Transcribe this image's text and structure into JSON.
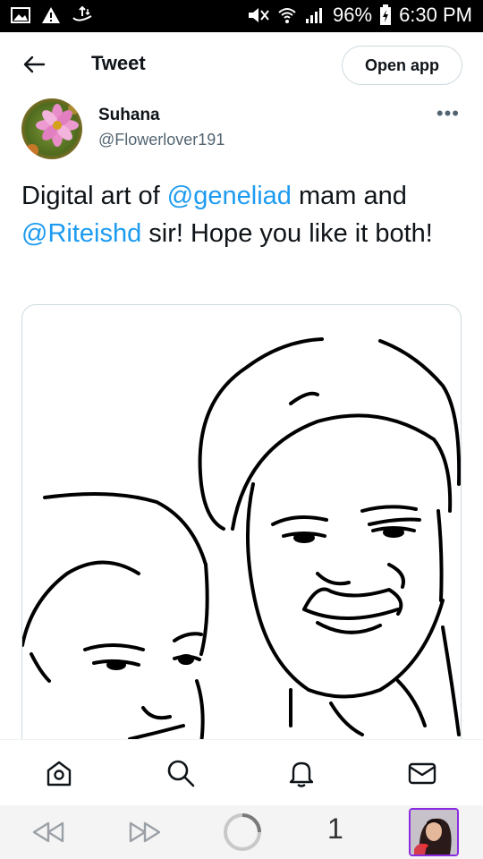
{
  "status_bar": {
    "battery": "96%",
    "time": "6:30 PM"
  },
  "header": {
    "title": "Tweet",
    "open_app_label": "Open app"
  },
  "tweet": {
    "author_name": "Suhana",
    "author_handle": "@Flowerlover191",
    "more_label": "•••",
    "text_parts": {
      "p1": "Digital art of ",
      "mention1": "@geneliad",
      "p2": " mam and ",
      "mention2": "@Riteishd",
      "p3": " sir! Hope you like it both!"
    },
    "media_description_icon": "line-art-drawing"
  },
  "bottom_nav": {
    "items": [
      "home-icon",
      "search-icon",
      "notifications-icon",
      "messages-icon"
    ]
  },
  "browser_bar": {
    "tab_count": "1"
  },
  "colors": {
    "accent": "#1d9bf0",
    "text": "#0f1419",
    "secondary": "#536471"
  }
}
